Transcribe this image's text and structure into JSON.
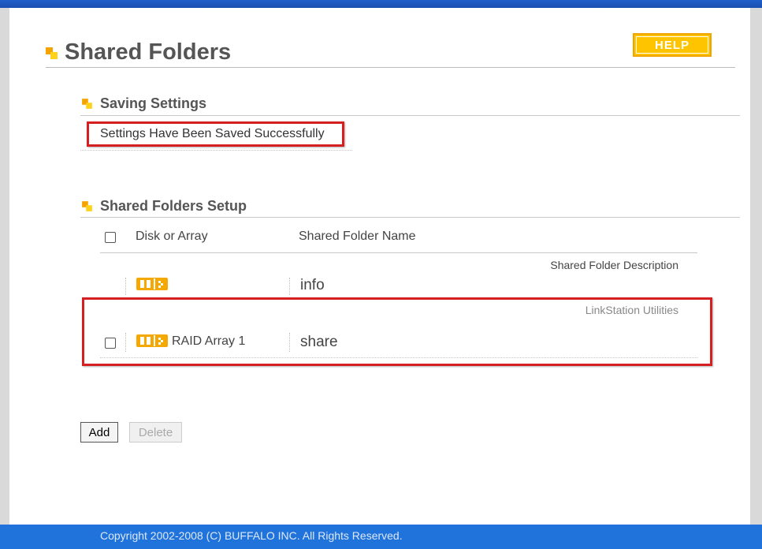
{
  "page": {
    "title": "Shared Folders",
    "help_label": "HELP"
  },
  "saving": {
    "title": "Saving Settings",
    "message": "Settings Have Been Saved Successfully"
  },
  "setup": {
    "title": "Shared Folders Setup",
    "columns": {
      "disk": "Disk or Array",
      "name": "Shared Folder Name",
      "description": "Shared Folder Description"
    },
    "rows": [
      {
        "disk": "",
        "name": "info",
        "description": "Shared Folder Description",
        "has_checkbox": false
      },
      {
        "disk": "RAID Array 1",
        "name": "share",
        "description": "LinkStation Utilities",
        "has_checkbox": true
      }
    ]
  },
  "actions": {
    "add_label": "Add",
    "delete_label": "Delete"
  },
  "footer": {
    "copyright": "Copyright 2002-2008 (C) BUFFALO INC. All Rights Reserved."
  },
  "icons": [
    "bullet-icon",
    "disk-icon"
  ],
  "colors": {
    "accent": "#ffc400",
    "highlight_border": "#d42020",
    "footer_bg": "#2173dc"
  }
}
